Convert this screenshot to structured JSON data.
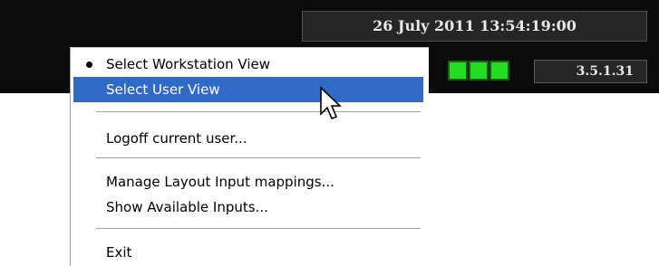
{
  "status_bar": {
    "datetime": "26 July 2011 13:54:19:00",
    "indicator_color": "#22dd22",
    "indicator_count": 3,
    "version": "3.5.1.31"
  },
  "context_menu": {
    "items": [
      {
        "label": "Select Workstation View",
        "checked": true
      },
      {
        "label": "Select User View",
        "highlighted": true
      },
      {
        "label": "Logoff current user..."
      },
      {
        "label": "Manage Layout Input mappings..."
      },
      {
        "label": "Show Available Inputs..."
      },
      {
        "label": "Exit"
      }
    ],
    "highlight_color": "#316ac5"
  }
}
